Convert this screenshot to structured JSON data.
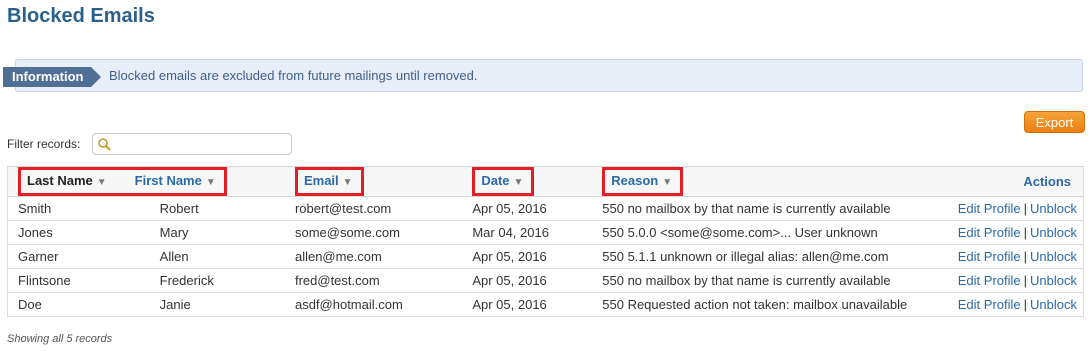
{
  "page": {
    "title": "Blocked Emails"
  },
  "info": {
    "tag": "Information",
    "message": "Blocked emails are excluded from future mailings until removed."
  },
  "toolbar": {
    "export_label": "Export"
  },
  "filter": {
    "label": "Filter records:",
    "value": "",
    "placeholder": ""
  },
  "table": {
    "headers": {
      "last_name": "Last Name",
      "first_name": "First Name",
      "email": "Email",
      "date": "Date",
      "reason": "Reason",
      "actions": "Actions"
    },
    "rows": [
      {
        "last_name": "Smith",
        "first_name": "Robert",
        "email": "robert@test.com",
        "date": "Apr 05, 2016",
        "reason": "550 no mailbox by that name is currently available",
        "edit": "Edit Profile",
        "unblock": "Unblock"
      },
      {
        "last_name": "Jones",
        "first_name": "Mary",
        "email": "some@some.com",
        "date": "Mar 04, 2016",
        "reason": "550 5.0.0 <some@some.com>... User unknown",
        "edit": "Edit Profile",
        "unblock": "Unblock"
      },
      {
        "last_name": "Garner",
        "first_name": "Allen",
        "email": "allen@me.com",
        "date": "Apr 05, 2016",
        "reason": "550 5.1.1 unknown or illegal alias: allen@me.com",
        "edit": "Edit Profile",
        "unblock": "Unblock"
      },
      {
        "last_name": "Flintsone",
        "first_name": "Frederick",
        "email": "fred@test.com",
        "date": "Apr 05, 2016",
        "reason": "550 no mailbox by that name is currently available",
        "edit": "Edit Profile",
        "unblock": "Unblock"
      },
      {
        "last_name": "Doe",
        "first_name": "Janie",
        "email": "asdf@hotmail.com",
        "date": "Apr 05, 2016",
        "reason": "550 Requested action not taken: mailbox unavailable",
        "edit": "Edit Profile",
        "unblock": "Unblock"
      }
    ]
  },
  "footer": {
    "summary": "Showing all 5 records"
  },
  "colors": {
    "title": "#2b5f8c",
    "link": "#2b6aa7",
    "export": "#ec7f12",
    "highlight": "#e21f26",
    "info_bg": "#e8eef8"
  },
  "icons": {
    "filter": "search-icon",
    "sort": "sort-down-icon"
  }
}
